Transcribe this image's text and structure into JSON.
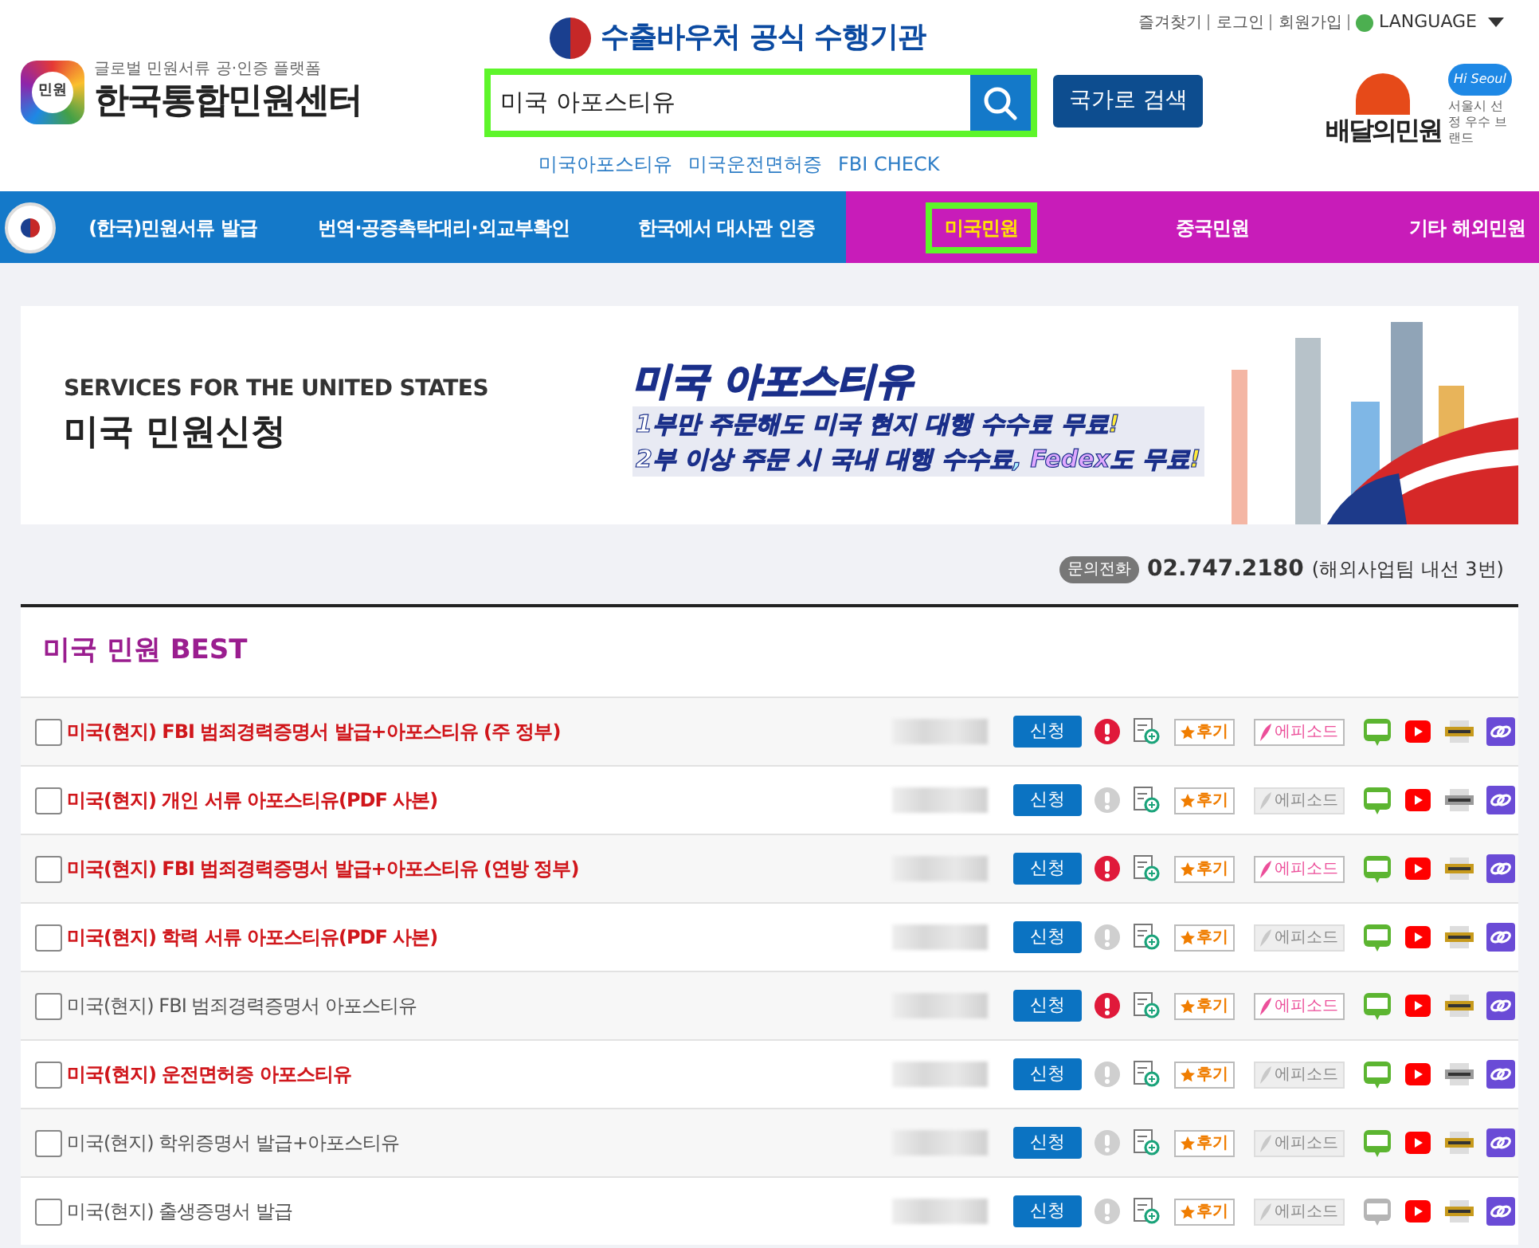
{
  "header": {
    "voucher_title": "수출바우처 공식 수행기관",
    "logo_tagline": "글로벌 민원서류 공·인증 플랫폼",
    "logo_name": "한국통합민원센터",
    "logo_badge": "민원",
    "top_links": [
      "즐겨찾기",
      "로그인",
      "회원가입"
    ],
    "language": "LANGUAGE",
    "search": {
      "value": "미국 아포스티유"
    },
    "country_button": "국가로 검색",
    "quick_links": [
      "미국아포스티유",
      "미국운전면허증",
      "FBI CHECK"
    ],
    "brand_name": "배달의민원",
    "brand_badge": "Hi Seoul",
    "brand_caption": "서울시 선정 우수 브랜드"
  },
  "nav_groups": [
    {
      "kind": "domestic",
      "items": [
        {
          "label": "(한국)민원서류 발급",
          "selected": false
        },
        {
          "label": "번역·공증촉탁대리·외교부확인",
          "selected": false
        },
        {
          "label": "한국에서 대사관 인증",
          "selected": false
        }
      ]
    },
    {
      "kind": "overseas",
      "items": [
        {
          "label": "미국민원",
          "selected": true
        },
        {
          "label": "중국민원",
          "selected": false
        },
        {
          "label": "기타 해외민원",
          "selected": false
        }
      ]
    }
  ],
  "banner": {
    "subtitle": "SERVICES FOR THE UNITED STATES",
    "title": "미국 민원신청",
    "promo_title": "미국 아포스티유",
    "promo_lines": [
      [
        {
          "text": "1부만 주문해도 ",
          "kind": "plain"
        },
        {
          "text": "미국 현지 대행 수수료 ",
          "kind": "highlight"
        },
        {
          "text": "무료!",
          "kind": "accent"
        }
      ],
      [
        {
          "text": "2부 이상 주문 시 ",
          "kind": "plain"
        },
        {
          "text": "국내 대행 수수료, ",
          "kind": "highlight"
        },
        {
          "text": "Fedex",
          "kind": "brand"
        },
        {
          "text": "도 ",
          "kind": "plain"
        },
        {
          "text": "무료!",
          "kind": "accent"
        }
      ]
    ]
  },
  "contact": {
    "badge": "문의전화",
    "phone": "02.747.2180",
    "note": "(해외사업팀 내선 3번)"
  },
  "best": {
    "title": "미국 민원 BEST",
    "rows": [
      {
        "title": "미국(현지) FBI 범죄경력증명서 발급+아포스티유 (주 정부)",
        "highlighted": true,
        "checked": false,
        "apply": "신청",
        "review": "후기",
        "episode": "에피소드",
        "alert": true,
        "episode_on": true,
        "blog_on": true,
        "news_on": true
      },
      {
        "title": "미국(현지) 개인 서류 아포스티유(PDF 사본)",
        "highlighted": true,
        "checked": false,
        "apply": "신청",
        "review": "후기",
        "episode": "에피소드",
        "alert": false,
        "episode_on": false,
        "blog_on": true,
        "news_on": false
      },
      {
        "title": "미국(현지) FBI 범죄경력증명서 발급+아포스티유 (연방 정부)",
        "highlighted": true,
        "checked": false,
        "apply": "신청",
        "review": "후기",
        "episode": "에피소드",
        "alert": true,
        "episode_on": true,
        "blog_on": true,
        "news_on": true
      },
      {
        "title": "미국(현지) 학력 서류 아포스티유(PDF 사본)",
        "highlighted": true,
        "checked": false,
        "apply": "신청",
        "review": "후기",
        "episode": "에피소드",
        "alert": false,
        "episode_on": false,
        "blog_on": true,
        "news_on": true
      },
      {
        "title": "미국(현지) FBI 범죄경력증명서 아포스티유",
        "highlighted": false,
        "checked": false,
        "apply": "신청",
        "review": "후기",
        "episode": "에피소드",
        "alert": true,
        "episode_on": true,
        "blog_on": true,
        "news_on": true
      },
      {
        "title": "미국(현지) 운전면허증 아포스티유",
        "highlighted": true,
        "checked": false,
        "apply": "신청",
        "review": "후기",
        "episode": "에피소드",
        "alert": false,
        "episode_on": false,
        "blog_on": true,
        "news_on": false
      },
      {
        "title": "미국(현지) 학위증명서 발급+아포스티유",
        "highlighted": false,
        "checked": false,
        "apply": "신청",
        "review": "후기",
        "episode": "에피소드",
        "alert": false,
        "episode_on": false,
        "blog_on": true,
        "news_on": true
      },
      {
        "title": "미국(현지) 출생증명서 발급",
        "highlighted": false,
        "checked": false,
        "apply": "신청",
        "review": "후기",
        "episode": "에피소드",
        "alert": false,
        "episode_on": false,
        "blog_on": false,
        "news_on": true
      }
    ]
  }
}
